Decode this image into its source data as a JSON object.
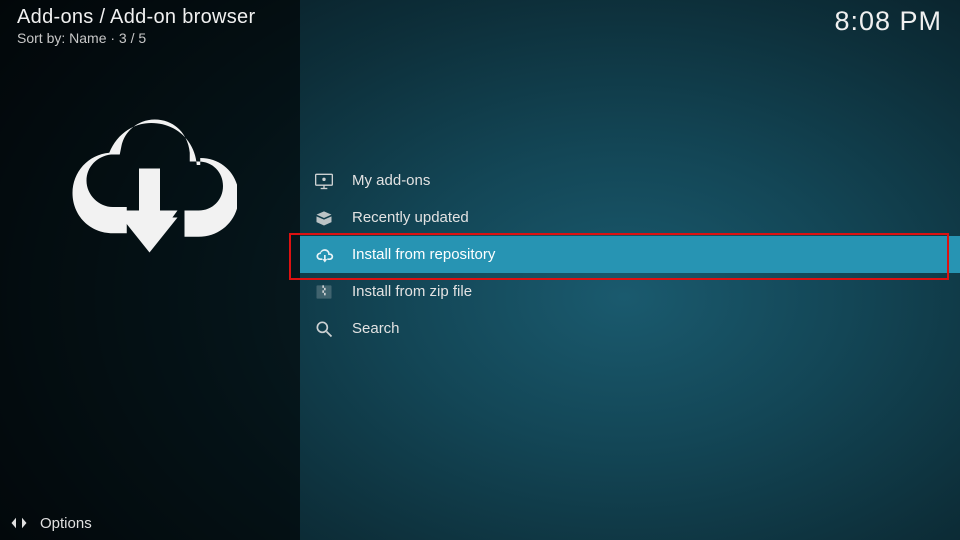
{
  "header": {
    "breadcrumb": "Add-ons / Add-on browser",
    "sort_line": "Sort by: Name  ·  3 / 5",
    "clock": "8:08 PM"
  },
  "footer": {
    "options_label": "Options"
  },
  "menu": {
    "items": [
      {
        "label": "My add-ons",
        "icon": "monitor-addons-icon",
        "selected": false
      },
      {
        "label": "Recently updated",
        "icon": "open-box-icon",
        "selected": false
      },
      {
        "label": "Install from repository",
        "icon": "cloud-download-icon",
        "selected": true
      },
      {
        "label": "Install from zip file",
        "icon": "zip-box-icon",
        "selected": false
      },
      {
        "label": "Search",
        "icon": "search-icon",
        "selected": false
      }
    ]
  }
}
